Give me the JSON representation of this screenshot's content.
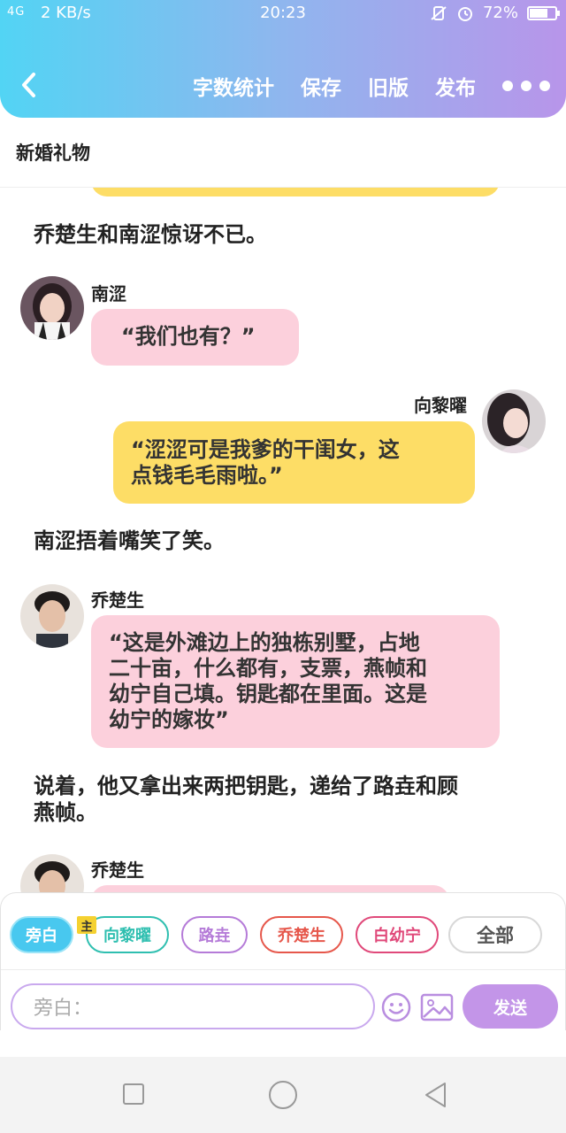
{
  "status_bar": {
    "signal": "4G",
    "speed": "2 KB/s",
    "time": "20:23",
    "battery": "72%",
    "battery_level": 0.72
  },
  "header": {
    "actions": [
      "字数统计",
      "保存",
      "旧版",
      "发布"
    ]
  },
  "document": {
    "title": "新婚礼物"
  },
  "messages": {
    "m1": {
      "text": "乔楚生和南涩惊讶不已。"
    },
    "m2": {
      "speaker": "南涩",
      "text": "“我们也有？”"
    },
    "m3": {
      "speaker": "向黎曜",
      "line1": "“涩涩可是我爹的干闺女，这",
      "line2": "点钱毛毛雨啦。”"
    },
    "m4": {
      "text": "南涩捂着嘴笑了笑。"
    },
    "m5": {
      "speaker": "乔楚生",
      "line1": "“这是外滩边上的独栋别墅，占地",
      "line2": "二十亩，什么都有，支票，燕帧和",
      "line3": "幼宁自己填。钥匙都在里面。这是",
      "line4": "幼宁的嫁妆”"
    },
    "m6": {
      "line1": "说着，他又拿出来两把钥匙，递给了路垚和顾",
      "line2": "燕帧。"
    },
    "m7": {
      "speaker": "乔楚生"
    }
  },
  "characters": {
    "host_badge": "主",
    "chips": [
      {
        "label": "旁白",
        "color": "#48c8ef"
      },
      {
        "label": "向黎曜",
        "color": "#2fbfb0"
      },
      {
        "label": "路垚",
        "color": "#b57bd8"
      },
      {
        "label": "乔楚生",
        "color": "#e6574b"
      },
      {
        "label": "白幼宁",
        "color": "#e0497a"
      },
      {
        "label": "全部",
        "color": "#555555"
      }
    ]
  },
  "composer": {
    "placeholder": "旁白：",
    "send_label": "发送"
  },
  "icons": {
    "back": "chevron-left-icon",
    "more": "more-dots-icon",
    "emoji": "smiley-icon",
    "image": "image-icon",
    "nav_square": "recent-apps-icon",
    "nav_circle": "home-icon",
    "nav_triangle": "back-triangle-icon"
  }
}
